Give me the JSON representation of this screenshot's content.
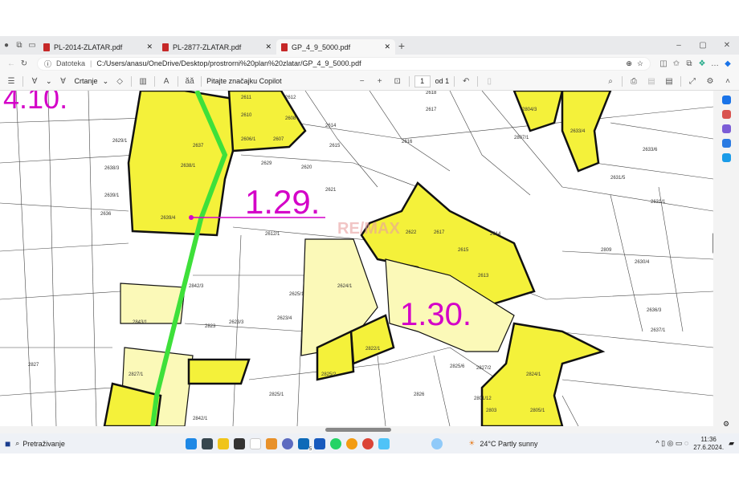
{
  "browser": {
    "tabs": [
      {
        "label": "PL-2014-ZLATAR.pdf",
        "active": false
      },
      {
        "label": "PL-2877-ZLATAR.pdf",
        "active": false
      },
      {
        "label": "GP_4_9_5000.pdf",
        "active": true
      }
    ],
    "address_prefix": "Datoteka",
    "url": "C:/Users/anasu/OneDrive/Desktop/prostrorni%20plan%20zlatar/GP_4_9_5000.pdf"
  },
  "pdf_toolbar": {
    "draw_label": "Crtanje",
    "copilot_label": "Pitajte značajku Copilot",
    "page": "1",
    "page_of": "od 1"
  },
  "map": {
    "zones": [
      "4.10.",
      "1.29.",
      "1.30."
    ],
    "watermark": "RE/MAX",
    "parcels": [
      "2611",
      "2612",
      "2608",
      "2607",
      "2606/1",
      "2610",
      "2614",
      "2615",
      "2616",
      "2617",
      "2618",
      "2637",
      "2638/1",
      "2638/3",
      "2639/1",
      "2639/4",
      "2636",
      "2629/1",
      "2629",
      "2620",
      "2621",
      "2622",
      "2617",
      "2615",
      "2614",
      "2613",
      "2823",
      "2825/1",
      "2825/2",
      "2827",
      "2827/1",
      "2843/1",
      "2842/1",
      "2842/3",
      "2825/6",
      "2826",
      "2824/1",
      "2801/12",
      "2803",
      "2804/3",
      "2807/1",
      "2633/4",
      "2633/6",
      "2631/1",
      "2631/5",
      "2630/4",
      "2636/3",
      "2637/1",
      "2612/1",
      "2625/1",
      "2623/3",
      "2623/4",
      "2624/1",
      "2822/1",
      "2827/2",
      "2805/1",
      "2809"
    ],
    "colors": {
      "developed": "#f4f13a",
      "planned": "#fbf9b8",
      "route": "#3ee03a",
      "label": "#d400c8"
    }
  },
  "taskbar": {
    "search": "Pretraživanje",
    "weather": "24°C  Partly sunny",
    "time": "11:36",
    "date": "27.6.2024.",
    "mail_badge": "5"
  }
}
